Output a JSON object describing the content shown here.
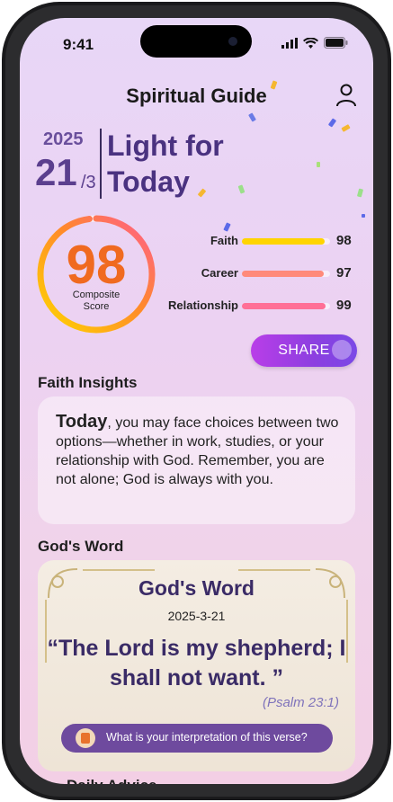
{
  "status": {
    "time": "9:41"
  },
  "header": {
    "title": "Spiritual Guide"
  },
  "date": {
    "year": "2025",
    "day": "21",
    "month": "/3"
  },
  "banner": {
    "line1": "Light for",
    "line2": "Today"
  },
  "composite": {
    "score": "98",
    "caption_line1": "Composite",
    "caption_line2": "Score",
    "value": 98
  },
  "scores": [
    {
      "label": "Faith",
      "value": "98",
      "color": "#ffd400"
    },
    {
      "label": "Career",
      "value": "97",
      "color": "#ff8a7a"
    },
    {
      "label": "Relationship",
      "value": "99",
      "color": "#ff6f96"
    }
  ],
  "share_label": "SHARE",
  "faith_insights": {
    "heading": "Faith Insights",
    "lead": "Today",
    "text": ", you may face choices between two options—whether in work, studies, or your relationship with God. Remember, you are not alone; God is always with you."
  },
  "gods_word": {
    "heading": "God's Word",
    "card_title": "God's Word",
    "date": "2025-3-21",
    "verse": "“The Lord is my shepherd; I shall not want. ”",
    "reference": "(Psalm 23:1)",
    "prompt": "What is your interpretation of this verse?"
  },
  "next_section_partial": "Daily Advice"
}
